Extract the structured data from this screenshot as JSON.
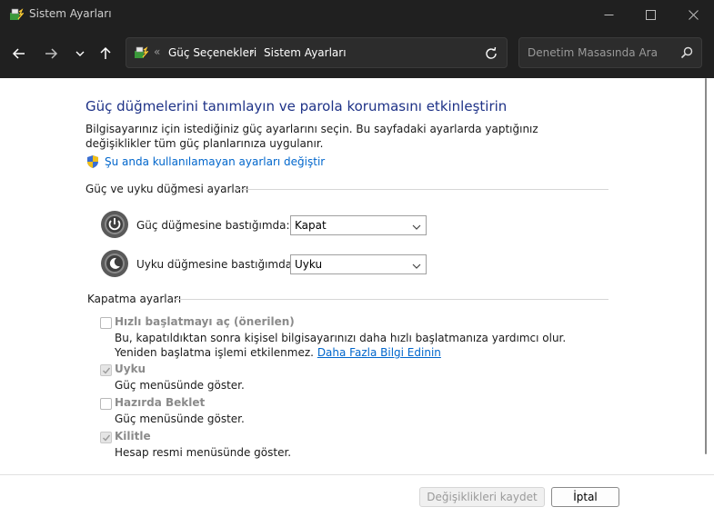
{
  "window": {
    "title": "Sistem Ayarları"
  },
  "address_bar": {
    "breadcrumb_prefix": "«",
    "crumb_1": "Güç Seçenekleri",
    "separator": "›",
    "crumb_2": "Sistem Ayarları"
  },
  "search": {
    "placeholder": "Denetim Masasında Ara"
  },
  "page": {
    "heading": "Güç düğmelerini tanımlayın ve parola korumasını etkinleştirin",
    "description": "Bilgisayarınız için istediğiniz güç ayarlarını seçin. Bu sayfadaki ayarlarda yaptığınız değişiklikler tüm güç planlarınıza uygulanır.",
    "change_link": "Şu anda kullanılamayan ayarları değiştir"
  },
  "power_section": {
    "title": "Güç ve uyku düğmesi ayarları",
    "power_button_label": "Güç düğmesine bastığımda:",
    "power_button_value": "Kapat",
    "sleep_button_label": "Uyku düğmesine bastığımda:",
    "sleep_button_value": "Uyku"
  },
  "shutdown_section": {
    "title": "Kapatma ayarları",
    "items": [
      {
        "label": "Hızlı başlatmayı aç (önerilen)",
        "description": "Bu, kapatıldıktan sonra kişisel bilgisayarınızı daha hızlı başlatmanıza yardımcı olur. Yeniden başlatma işlemi etkilenmez.",
        "link": "Daha Fazla Bilgi Edinin",
        "checked": false
      },
      {
        "label": "Uyku",
        "description": "Güç menüsünde göster.",
        "checked": true
      },
      {
        "label": "Hazırda Beklet",
        "description": "Güç menüsünde göster.",
        "checked": false
      },
      {
        "label": "Kilitle",
        "description": "Hesap resmi menüsünde göster.",
        "checked": true
      }
    ]
  },
  "footer": {
    "save_label": "Değişiklikleri kaydet",
    "cancel_label": "İptal"
  },
  "colors": {
    "heading": "#1e3287",
    "link": "#0066cc",
    "chrome": "#202020"
  }
}
